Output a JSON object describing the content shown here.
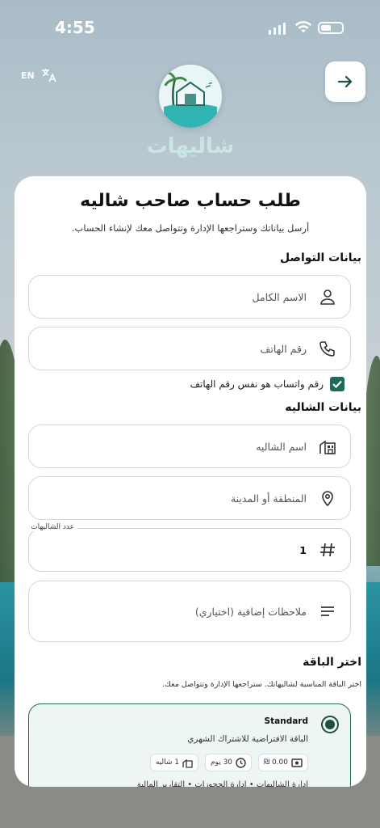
{
  "status_bar": {
    "time": "4:55"
  },
  "header": {
    "language_code": "EN",
    "brand_name": "شاليهات"
  },
  "form": {
    "title": "طلب حساب صاحب شاليه",
    "subtitle": "أرسل بياناتك وستراجعها الإدارة وتتواصل معك لإنشاء الحساب.",
    "contact_section": "بيانات التواصل",
    "full_name_placeholder": "الاسم الكامل",
    "phone_placeholder": "رقم الهاتف",
    "whatsapp_same_label": "رقم واتساب هو نفس رقم الهاتف",
    "whatsapp_same_checked": true,
    "chalet_section": "بيانات الشاليه",
    "chalet_name_placeholder": "اسم الشاليه",
    "region_placeholder": "المنطقة أو المدينة",
    "chalet_count_label": "عدد الشاليهات",
    "chalet_count_value": "1",
    "notes_placeholder": "ملاحظات إضافية (اختياري)",
    "package_section": "اختر الباقة",
    "package_hint": "اختر الباقة المناسبة لشاليهاتك. ستراجعها الإدارة وتتواصل معك."
  },
  "package": {
    "name": "Standard",
    "selected": true,
    "description": "الباقة الافتراضية للاشتراك الشهري",
    "price": "0.00 ₪",
    "duration": "30 يوم",
    "chalets": "1 شاليه",
    "features": "إدارة الشاليهات • إدارة الحجوزات • التقارير المالية"
  },
  "colors": {
    "accent": "#1e6b5a",
    "card": "#ffffff",
    "border": "#d8d8d8"
  }
}
